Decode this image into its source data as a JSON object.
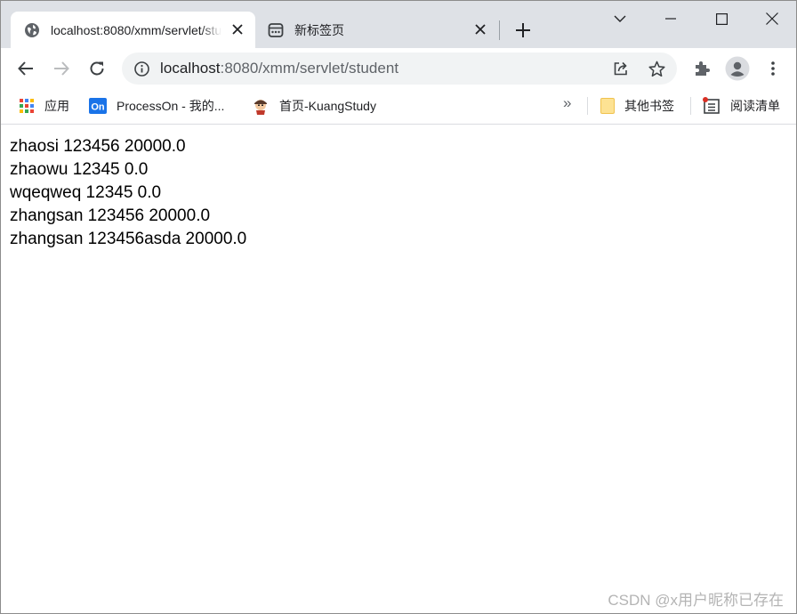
{
  "tabs": [
    {
      "title": "localhost:8080/xmm/servlet/student",
      "icon": "globe-icon",
      "active": true
    },
    {
      "title": "新标签页",
      "icon": "newtab-page-icon",
      "active": false
    }
  ],
  "address_bar": {
    "host": "localhost",
    "rest": ":8080/xmm/servlet/student"
  },
  "bookmarks": [
    {
      "label": "应用",
      "icon": "apps-grid-icon"
    },
    {
      "label": "ProcessOn - 我的...",
      "icon": "processon-logo-icon"
    },
    {
      "label": "首页-KuangStudy",
      "icon": "kuangstudy-avatar-icon"
    }
  ],
  "bookmarks_overflow": "»",
  "other_bookmarks": {
    "label": "其他书签",
    "icon": "folder-icon"
  },
  "reading_list": {
    "label": "阅读清单",
    "icon": "reading-list-icon"
  },
  "page": {
    "lines": [
      "zhaosi 123456 20000.0",
      "zhaowu 12345 0.0",
      "wqeqweq 12345 0.0",
      "zhangsan 123456 20000.0",
      "zhangsan 123456asda 20000.0"
    ]
  },
  "watermark": "CSDN @x用户昵称已存在",
  "colors": {
    "tabstrip": "#dee1e6",
    "omnibox": "#f1f3f4",
    "icon_gray": "#5f6368",
    "text": "#202124"
  }
}
